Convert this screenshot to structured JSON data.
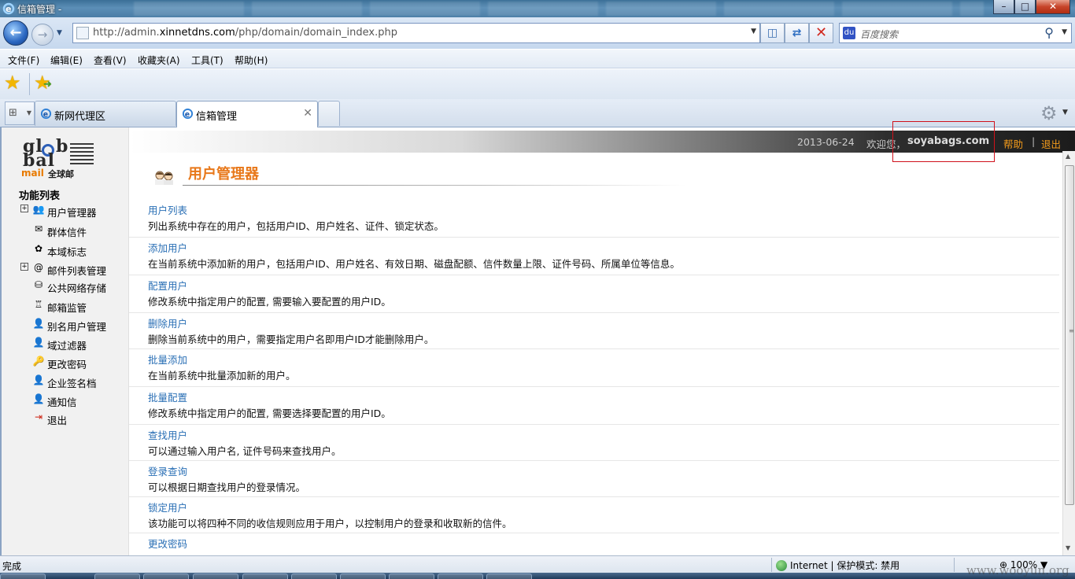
{
  "window": {
    "title": "信箱管理 -"
  },
  "address_bar": {
    "url_prefix": "http://admin.",
    "url_domain": "xinnetdns.com",
    "url_path": "/php/domain/domain_index.php"
  },
  "search_box": {
    "placeholder": "百度搜索"
  },
  "menu": {
    "items": [
      "文件(F)",
      "编辑(E)",
      "查看(V)",
      "收藏夹(A)",
      "工具(T)",
      "帮助(H)"
    ]
  },
  "tabs": [
    {
      "label": "新网代理区"
    },
    {
      "label": "信箱管理"
    }
  ],
  "sidebar": {
    "logo": {
      "line1": "gl",
      "line1b": "b",
      "line2": "bal",
      "mail": "mail",
      "mail_cn": "全球邮"
    },
    "title": "功能列表",
    "items": [
      {
        "label": "用户管理器",
        "icon": "users-icon",
        "expandable": true
      },
      {
        "label": "群体信件",
        "icon": "group-mail-icon",
        "expandable": false
      },
      {
        "label": "本域标志",
        "icon": "domain-logo-icon",
        "expandable": false
      },
      {
        "label": "邮件列表管理",
        "icon": "mail-list-icon",
        "expandable": true
      },
      {
        "label": "公共网络存储",
        "icon": "network-storage-icon",
        "expandable": false
      },
      {
        "label": "邮箱监管",
        "icon": "mailbox-monitor-icon",
        "expandable": false
      },
      {
        "label": "别名用户管理",
        "icon": "user-icon",
        "expandable": false
      },
      {
        "label": "域过滤器",
        "icon": "user-icon",
        "expandable": false
      },
      {
        "label": "更改密码",
        "icon": "key-icon",
        "expandable": false
      },
      {
        "label": "企业签名档",
        "icon": "user-icon",
        "expandable": false
      },
      {
        "label": "通知信",
        "icon": "user-icon",
        "expandable": false
      },
      {
        "label": "退出",
        "icon": "exit-icon",
        "expandable": false
      }
    ]
  },
  "topbar": {
    "date": "2013-06-24",
    "welcome": "欢迎您，",
    "user": "soyabags.com",
    "help": "帮助",
    "separator": "|",
    "logout": "退出"
  },
  "main": {
    "title": "用户管理器",
    "entries": [
      {
        "link": "用户列表",
        "desc": "列出系统中存在的用户，包括用户ID、用户姓名、证件、锁定状态。"
      },
      {
        "link": "添加用户",
        "desc": "在当前系统中添加新的用户，包括用户ID、用户姓名、有效日期、磁盘配额、信件数量上限、证件号码、所属单位等信息。"
      },
      {
        "link": "配置用户",
        "desc": "修改系统中指定用户的配置, 需要输入要配置的用户ID。"
      },
      {
        "link": "删除用户",
        "desc": "删除当前系统中的用户，需要指定用户名即用户ID才能删除用户。"
      },
      {
        "link": "批量添加",
        "desc": "在当前系统中批量添加新的用户。"
      },
      {
        "link": "批量配置",
        "desc": "修改系统中指定用户的配置, 需要选择要配置的用户ID。"
      },
      {
        "link": "查找用户",
        "desc": "可以通过输入用户名, 证件号码来查找用户。"
      },
      {
        "link": "登录查询",
        "desc": "可以根据日期查找用户的登录情况。"
      },
      {
        "link": "锁定用户",
        "desc": "该功能可以将四种不同的收信规则应用于用户，以控制用户的登录和收取新的信件。"
      },
      {
        "link": "更改密码",
        "desc": ""
      }
    ]
  },
  "statusbar": {
    "status": "完成",
    "zone": "Internet | 保护模式: 禁用",
    "zoom": "100%"
  },
  "watermark": "www.wooyun.org",
  "colors": {
    "accent_orange": "#e8781a",
    "link_blue": "#2a6fb5",
    "highlight_red": "#d0111b"
  }
}
